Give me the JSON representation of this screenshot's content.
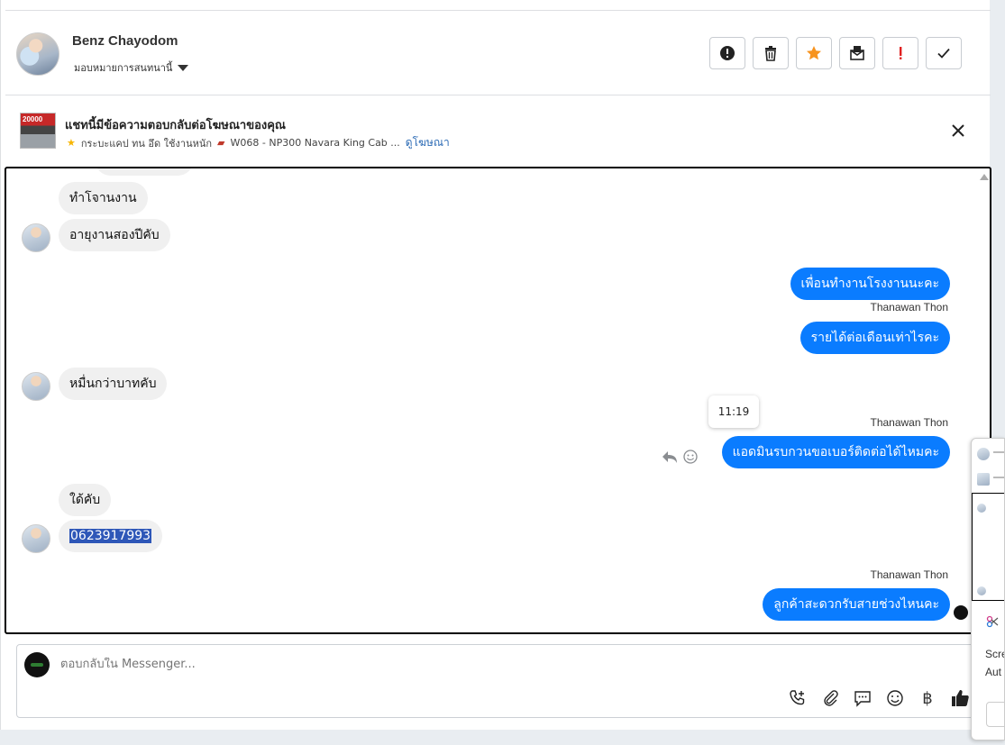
{
  "header": {
    "contact_name": "Benz Chayodom",
    "assign_label": "มอบหมายการสนทนานี้",
    "tools": [
      "report-icon",
      "trash-icon",
      "star-icon",
      "mark-unread-icon",
      "spam-icon",
      "done-icon"
    ]
  },
  "ad_banner": {
    "thumb_tag": "20000",
    "title": "แชทนี้มีข้อความตอบกลับต่อโฆษณาของคุณ",
    "subtitle": "กระบะแคป ทน อึด ใช้งานหนัก",
    "model": "W068 - NP300 Navara King Cab ...",
    "link": "ดูโฆษณา"
  },
  "messages": [
    {
      "dir": "in",
      "text": "ทำโจานงาน"
    },
    {
      "dir": "in",
      "text": "อายุงานสองปีคับ"
    },
    {
      "dir": "out",
      "text": "เพื่อนทำงานโรงงานนะคะ"
    },
    {
      "dir": "out",
      "sender": "Thanawan Thon",
      "text": "รายได้ต่อเดือนเท่าไรคะ"
    },
    {
      "dir": "in",
      "text": "หมื่นกว่าบาทคับ"
    },
    {
      "dir": "out",
      "sender": "Thanawan Thon",
      "text": "แอดมินรบกวนขอเบอร์ติดต่อได้ไหมคะ",
      "time": "11:19"
    },
    {
      "dir": "in",
      "text": "ใด้คับ"
    },
    {
      "dir": "in",
      "text": "0623917993"
    },
    {
      "dir": "out",
      "sender": "Thanawan Thon",
      "text": "ลูกค้าสะดวกรับสายช่วงไหนคะ"
    }
  ],
  "composer": {
    "placeholder": "ตอบกลับใน Messenger...",
    "tools": [
      "add-call-icon",
      "attach-icon",
      "saved-replies-icon",
      "emoji-icon",
      "payment-icon",
      "like-icon"
    ],
    "baht_glyph": "฿"
  },
  "peek_panel": {
    "line1": "Scre",
    "line2": "Aut"
  },
  "colors": {
    "outgoing_bubble": "#0a7cff",
    "incoming_bubble": "#f0f0f0",
    "star": "#f7931e",
    "spam": "#e02020"
  }
}
